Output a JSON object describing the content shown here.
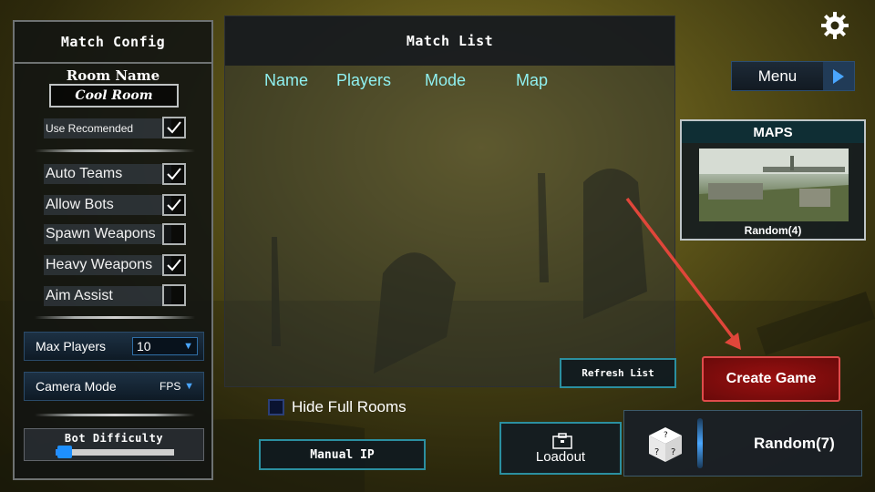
{
  "match_config": {
    "title": "Match Config",
    "room_name_label": "Room Name",
    "room_name_value": "Cool Room",
    "use_recommended": {
      "label": "Use Recomended",
      "checked": true
    },
    "options": [
      {
        "label": "Auto Teams",
        "checked": true
      },
      {
        "label": "Allow Bots",
        "checked": true
      },
      {
        "label": "Spawn Weapons",
        "checked": false
      },
      {
        "label": "Heavy Weapons",
        "checked": true
      },
      {
        "label": "Aim Assist",
        "checked": false
      }
    ],
    "max_players": {
      "label": "Max Players",
      "value": "10"
    },
    "camera_mode": {
      "label": "Camera Mode",
      "value": "FPS"
    },
    "bot_difficulty": {
      "label": "Bot Difficulty",
      "level": 0.08
    }
  },
  "match_list": {
    "title": "Match List",
    "columns": [
      "Name",
      "Players",
      "Mode",
      "Map"
    ],
    "rows": []
  },
  "hide_full_rooms": {
    "label": "Hide Full Rooms",
    "checked": false
  },
  "buttons": {
    "refresh": "Refresh List",
    "manual_ip": "Manual IP",
    "loadout": "Loadout",
    "menu": "Menu",
    "create_game": "Create Game"
  },
  "maps": {
    "title": "MAPS",
    "selected": "Random(4)"
  },
  "mode_selector": {
    "label": "Random(7)"
  },
  "icons": {
    "settings": "gear-icon",
    "menu_arrow": "play-arrow-icon",
    "dice": "dice-icon",
    "loadout": "briefcase-icon",
    "checkbox": "checkmark-icon"
  },
  "colors": {
    "accent_cyan": "#2b8fa0",
    "column_text": "#8ff0f0",
    "create_red": "#9a1010",
    "arrow_red": "#e0463a",
    "slider_blue": "#1e90ff"
  }
}
